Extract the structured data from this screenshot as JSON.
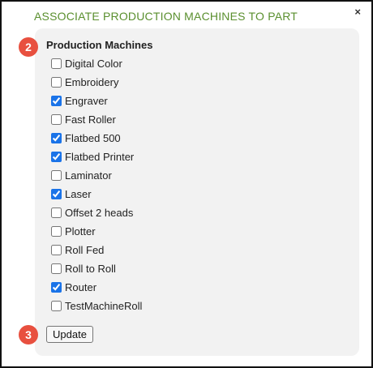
{
  "dialog": {
    "title": "ASSOCIATE PRODUCTION MACHINES TO PART",
    "close_label": "×"
  },
  "section": {
    "label": "Production Machines"
  },
  "machines": [
    {
      "label": "Digital Color",
      "checked": false
    },
    {
      "label": "Embroidery",
      "checked": false
    },
    {
      "label": "Engraver",
      "checked": true
    },
    {
      "label": "Fast Roller",
      "checked": false
    },
    {
      "label": "Flatbed 500",
      "checked": true
    },
    {
      "label": "Flatbed Printer",
      "checked": true
    },
    {
      "label": "Laminator",
      "checked": false
    },
    {
      "label": "Laser",
      "checked": true
    },
    {
      "label": "Offset 2 heads",
      "checked": false
    },
    {
      "label": "Plotter",
      "checked": false
    },
    {
      "label": "Roll Fed",
      "checked": false
    },
    {
      "label": "Roll to Roll",
      "checked": false
    },
    {
      "label": "Router",
      "checked": true
    },
    {
      "label": "TestMachineRoll",
      "checked": false
    }
  ],
  "badges": {
    "step_2": "2",
    "step_3": "3"
  },
  "actions": {
    "update_label": "Update"
  },
  "colors": {
    "title": "#5a8f2e",
    "badge": "#e8503f",
    "panel": "#f2f2f2"
  }
}
